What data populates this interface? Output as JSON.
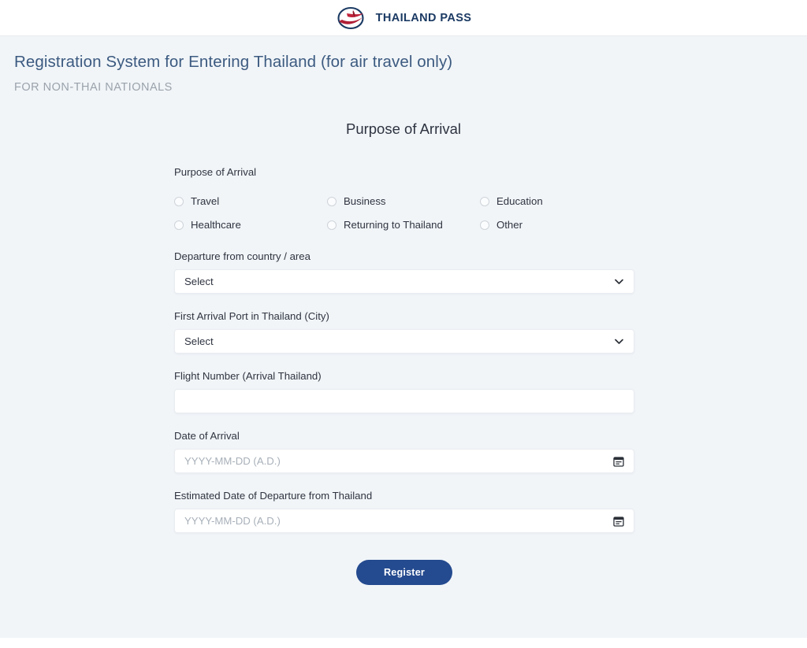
{
  "header": {
    "brand_name": "THAILAND PASS",
    "logo_icon": "thailand-pass-globe-bird-logo"
  },
  "intro": {
    "title": "Registration System for Entering Thailand (for air travel only)",
    "subtitle": "FOR NON-THAI NATIONALS"
  },
  "section": {
    "heading": "Purpose of Arrival"
  },
  "form": {
    "purpose": {
      "label": "Purpose of Arrival",
      "options": [
        {
          "label": "Travel",
          "selected": false
        },
        {
          "label": "Business",
          "selected": false
        },
        {
          "label": "Education",
          "selected": false
        },
        {
          "label": "Healthcare",
          "selected": false
        },
        {
          "label": "Returning to Thailand",
          "selected": false
        },
        {
          "label": "Other",
          "selected": false
        }
      ]
    },
    "departure_country": {
      "label": "Departure from country / area",
      "value": "Select",
      "icon": "chevron-down-icon"
    },
    "arrival_port": {
      "label": "First Arrival Port in Thailand (City)",
      "value": "Select",
      "icon": "chevron-down-icon"
    },
    "flight_number": {
      "label": "Flight Number (Arrival Thailand)",
      "value": "",
      "placeholder": ""
    },
    "date_of_arrival": {
      "label": "Date of Arrival",
      "value": "",
      "placeholder": "YYYY-MM-DD (A.D.)",
      "icon": "calendar-icon"
    },
    "date_of_departure": {
      "label": "Estimated Date of Departure from Thailand",
      "value": "",
      "placeholder": "YYYY-MM-DD (A.D.)",
      "icon": "calendar-icon"
    },
    "submit": {
      "label": "Register"
    }
  },
  "colors": {
    "brand_navy": "#1b3a63",
    "brand_red": "#c0243c",
    "title_blue": "#3c5a80",
    "button_blue": "#244a8f",
    "page_bg": "#f1f5f8"
  }
}
